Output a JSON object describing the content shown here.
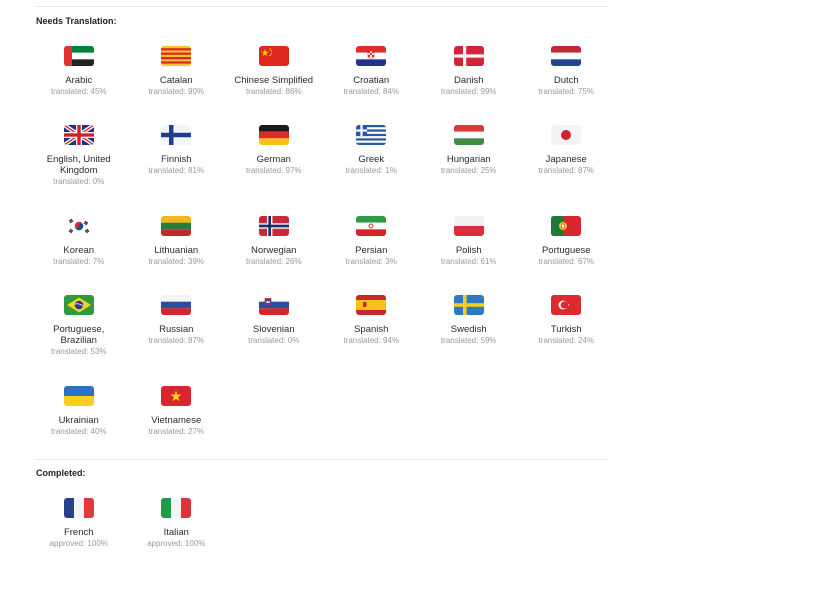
{
  "sections": {
    "needs_translation": {
      "title": "Needs Translation:",
      "languages": [
        {
          "name": "Arabic",
          "progress": "translated: 45%",
          "percent": 45,
          "flag": "uae-flag-icon"
        },
        {
          "name": "Catalan",
          "progress": "translated: 90%",
          "percent": 90,
          "flag": "catalonia-flag-icon"
        },
        {
          "name": "Chinese Simplified",
          "progress": "translated: 86%",
          "percent": 86,
          "flag": "china-flag-icon"
        },
        {
          "name": "Croatian",
          "progress": "translated: 84%",
          "percent": 84,
          "flag": "croatia-flag-icon"
        },
        {
          "name": "Danish",
          "progress": "translated: 99%",
          "percent": 99,
          "flag": "denmark-flag-icon"
        },
        {
          "name": "Dutch",
          "progress": "translated: 75%",
          "percent": 75,
          "flag": "netherlands-flag-icon"
        },
        {
          "name": "English, United Kingdom",
          "progress": "translated: 0%",
          "percent": 0,
          "flag": "uk-flag-icon"
        },
        {
          "name": "Finnish",
          "progress": "translated: 81%",
          "percent": 81,
          "flag": "finland-flag-icon"
        },
        {
          "name": "German",
          "progress": "translated: 97%",
          "percent": 97,
          "flag": "germany-flag-icon"
        },
        {
          "name": "Greek",
          "progress": "translated: 1%",
          "percent": 1,
          "flag": "greece-flag-icon"
        },
        {
          "name": "Hungarian",
          "progress": "translated: 25%",
          "percent": 25,
          "flag": "hungary-flag-icon"
        },
        {
          "name": "Japanese",
          "progress": "translated: 87%",
          "percent": 87,
          "flag": "japan-flag-icon"
        },
        {
          "name": "Korean",
          "progress": "translated: 7%",
          "percent": 7,
          "flag": "south-korea-flag-icon"
        },
        {
          "name": "Lithuanian",
          "progress": "translated: 39%",
          "percent": 39,
          "flag": "lithuania-flag-icon"
        },
        {
          "name": "Norwegian",
          "progress": "translated: 26%",
          "percent": 26,
          "flag": "norway-flag-icon"
        },
        {
          "name": "Persian",
          "progress": "translated: 3%",
          "percent": 3,
          "flag": "iran-flag-icon"
        },
        {
          "name": "Polish",
          "progress": "translated: 61%",
          "percent": 61,
          "flag": "poland-flag-icon"
        },
        {
          "name": "Portuguese",
          "progress": "translated: 67%",
          "percent": 67,
          "flag": "portugal-flag-icon"
        },
        {
          "name": "Portuguese, Brazilian",
          "progress": "translated: 53%",
          "percent": 53,
          "flag": "brazil-flag-icon"
        },
        {
          "name": "Russian",
          "progress": "translated: 87%",
          "percent": 87,
          "flag": "russia-flag-icon"
        },
        {
          "name": "Slovenian",
          "progress": "translated: 0%",
          "percent": 0,
          "flag": "slovenia-flag-icon"
        },
        {
          "name": "Spanish",
          "progress": "translated: 94%",
          "percent": 94,
          "flag": "spain-flag-icon"
        },
        {
          "name": "Swedish",
          "progress": "translated: 59%",
          "percent": 59,
          "flag": "sweden-flag-icon"
        },
        {
          "name": "Turkish",
          "progress": "translated: 24%",
          "percent": 24,
          "flag": "turkey-flag-icon"
        },
        {
          "name": "Ukrainian",
          "progress": "translated: 40%",
          "percent": 40,
          "flag": "ukraine-flag-icon"
        },
        {
          "name": "Vietnamese",
          "progress": "translated: 27%",
          "percent": 27,
          "flag": "vietnam-flag-icon"
        }
      ]
    },
    "completed": {
      "title": "Completed:",
      "languages": [
        {
          "name": "French",
          "progress": "approved: 100%",
          "percent": 100,
          "flag": "france-flag-icon"
        },
        {
          "name": "Italian",
          "progress": "approved: 100%",
          "percent": 100,
          "flag": "italy-flag-icon"
        }
      ]
    }
  }
}
